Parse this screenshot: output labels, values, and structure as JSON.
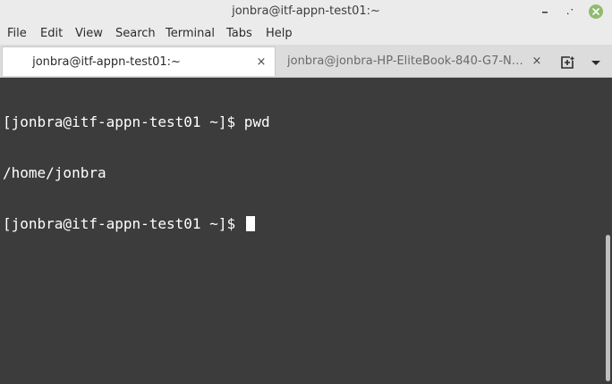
{
  "window": {
    "title": "jonbra@itf-appn-test01:~",
    "controls": [
      "minimize-icon",
      "maximize-icon",
      "close-icon"
    ],
    "close_color": "#8fbb6e"
  },
  "menu": {
    "items": [
      "File",
      "Edit",
      "View",
      "Search",
      "Terminal",
      "Tabs",
      "Help"
    ]
  },
  "tabs": [
    {
      "label": "jonbra@itf-appn-test01:~",
      "active": true,
      "close": "×"
    },
    {
      "label": "jonbra@jonbra-HP-EliteBook-840-G7-Not…",
      "active": false,
      "close": "×"
    }
  ],
  "tab_actions": [
    "new-tab-icon",
    "tab-menu-icon"
  ],
  "terminal": {
    "lines": [
      "[jonbra@itf-appn-test01 ~]$ pwd",
      "/home/jonbra",
      "[jonbra@itf-appn-test01 ~]$ "
    ],
    "background": "#3c3c3c",
    "foreground": "#ffffff"
  }
}
